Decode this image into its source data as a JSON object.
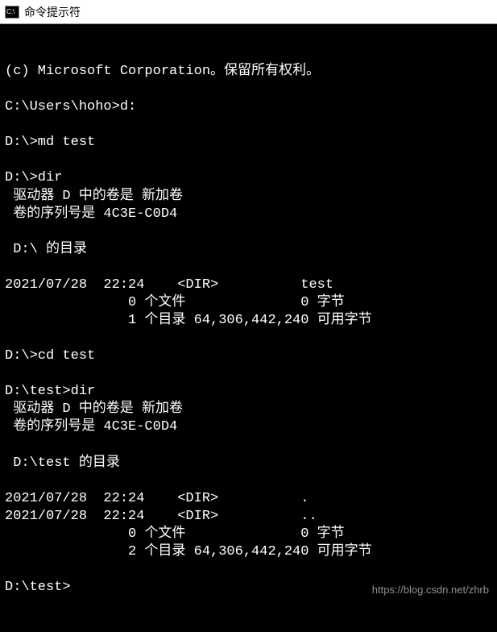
{
  "titlebar": {
    "icon_label": "C:\\",
    "title": "命令提示符"
  },
  "terminal": {
    "lines": [
      "(c) Microsoft Corporation。保留所有权利。",
      "",
      "C:\\Users\\hoho>d:",
      "",
      "D:\\>md test",
      "",
      "D:\\>dir",
      " 驱动器 D 中的卷是 新加卷",
      " 卷的序列号是 4C3E-C0D4",
      "",
      " D:\\ 的目录",
      "",
      "2021/07/28  22:24    <DIR>          test",
      "               0 个文件              0 字节",
      "               1 个目录 64,306,442,240 可用字节",
      "",
      "D:\\>cd test",
      "",
      "D:\\test>dir",
      " 驱动器 D 中的卷是 新加卷",
      " 卷的序列号是 4C3E-C0D4",
      "",
      " D:\\test 的目录",
      "",
      "2021/07/28  22:24    <DIR>          .",
      "2021/07/28  22:24    <DIR>          ..",
      "               0 个文件              0 字节",
      "               2 个目录 64,306,442,240 可用字节",
      "",
      "D:\\test>"
    ]
  },
  "watermark": "https://blog.csdn.net/zhrb"
}
